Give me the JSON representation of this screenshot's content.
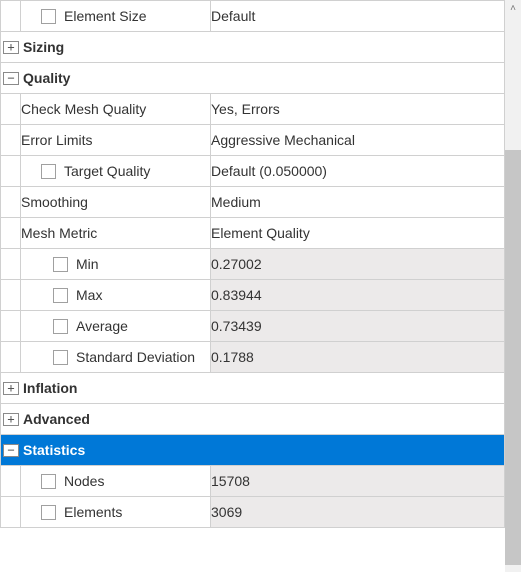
{
  "rows": {
    "element_size": {
      "label": "Element Size",
      "value": "Default"
    }
  },
  "groups": {
    "sizing": {
      "label": "Sizing",
      "expanded": false
    },
    "quality": {
      "label": "Quality",
      "expanded": true
    },
    "inflation": {
      "label": "Inflation",
      "expanded": false
    },
    "advanced": {
      "label": "Advanced",
      "expanded": false
    },
    "statistics": {
      "label": "Statistics",
      "expanded": true,
      "selected": true
    }
  },
  "quality": {
    "check_mesh_quality": {
      "label": "Check Mesh Quality",
      "value": "Yes, Errors"
    },
    "error_limits": {
      "label": "Error Limits",
      "value": "Aggressive Mechanical"
    },
    "target_quality": {
      "label": "Target Quality",
      "value": "Default (0.050000)"
    },
    "smoothing": {
      "label": "Smoothing",
      "value": "Medium"
    },
    "mesh_metric": {
      "label": "Mesh Metric",
      "value": "Element Quality"
    },
    "metrics": {
      "min": {
        "label": "Min",
        "value": "0.27002"
      },
      "max": {
        "label": "Max",
        "value": "0.83944"
      },
      "avg": {
        "label": "Average",
        "value": "0.73439"
      },
      "stddev": {
        "label": "Standard Deviation",
        "value": "0.1788"
      }
    }
  },
  "statistics": {
    "nodes": {
      "label": "Nodes",
      "value": "15708"
    },
    "elements": {
      "label": "Elements",
      "value": "3069"
    }
  },
  "icons": {
    "plus": "+",
    "minus": "−",
    "up": "˄"
  }
}
